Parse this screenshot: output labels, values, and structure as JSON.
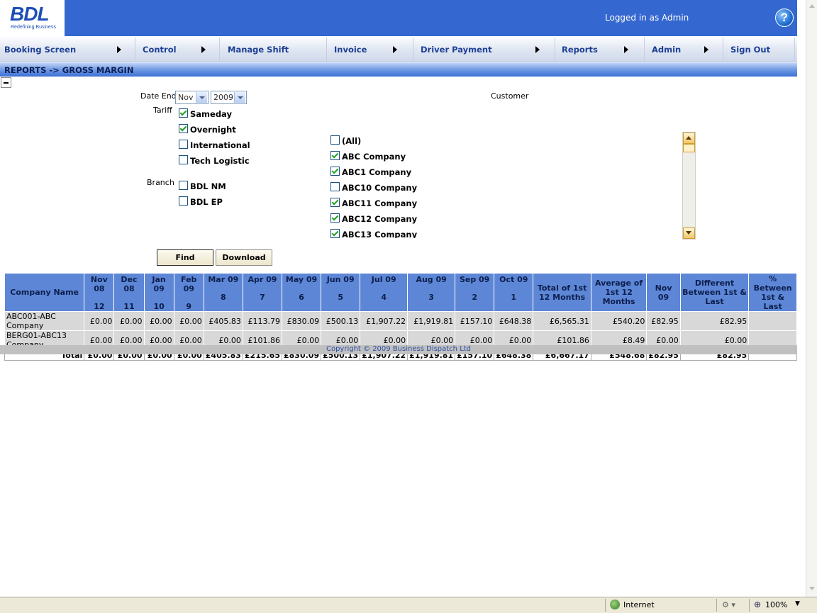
{
  "header": {
    "logo": "BDL",
    "logo_tagline": "Redefining Business",
    "logged_in": "Logged in as Admin",
    "help_icon": "?"
  },
  "menu": [
    {
      "label": "Booking Screen"
    },
    {
      "label": "Control"
    },
    {
      "label": "Manage Shift"
    },
    {
      "label": "Invoice"
    },
    {
      "label": "Driver Payment"
    },
    {
      "label": "Reports"
    },
    {
      "label": "Admin"
    },
    {
      "label": "Sign Out"
    }
  ],
  "title": "REPORTS -> GROSS MARGIN",
  "form": {
    "date_end_label": "Date End",
    "month_value": "Nov",
    "year_value": "2009",
    "tariff_label": "Tariff",
    "tariffs": [
      {
        "label": "Sameday",
        "checked": true
      },
      {
        "label": "Overnight",
        "checked": true
      },
      {
        "label": "International",
        "checked": false
      },
      {
        "label": "Tech Logistic",
        "checked": false
      }
    ],
    "branch_label": "Branch",
    "branches": [
      {
        "label": "BDL NM",
        "checked": false
      },
      {
        "label": "BDL EP",
        "checked": false
      }
    ],
    "customer_label": "Customer",
    "customers": [
      {
        "label": "(All)",
        "checked": false
      },
      {
        "label": "ABC Company",
        "checked": true
      },
      {
        "label": "ABC1 Company",
        "checked": true
      },
      {
        "label": "ABC10 Company",
        "checked": false
      },
      {
        "label": "ABC11 Company",
        "checked": true
      },
      {
        "label": "ABC12 Company",
        "checked": true
      },
      {
        "label": "ABC13 Company",
        "checked": true
      }
    ],
    "find_label": "Find",
    "download_label": "Download"
  },
  "table": {
    "company_header": "Company Name",
    "months": [
      {
        "name": "Nov 08",
        "num": "12"
      },
      {
        "name": "Dec 08",
        "num": "11"
      },
      {
        "name": "Jan 09",
        "num": "10"
      },
      {
        "name": "Feb 09",
        "num": "9"
      },
      {
        "name": "Mar 09",
        "num": "8"
      },
      {
        "name": "Apr 09",
        "num": "7"
      },
      {
        "name": "May 09",
        "num": "6"
      },
      {
        "name": "Jun 09",
        "num": "5"
      },
      {
        "name": "Jul 09",
        "num": "4"
      },
      {
        "name": "Aug 09",
        "num": "3"
      },
      {
        "name": "Sep 09",
        "num": "2"
      },
      {
        "name": "Oct 09",
        "num": "1"
      }
    ],
    "extra_headers": [
      "Total of 1st 12 Months",
      "Average of 1st 12 Months",
      "Nov 09",
      "Different Between 1st & Last",
      "% Between 1st & Last"
    ],
    "rows": [
      {
        "company": "ABC001-ABC Company",
        "values": [
          "£0.00",
          "£0.00",
          "£0.00",
          "£0.00",
          "£405.83",
          "£113.79",
          "£830.09",
          "£500.13",
          "£1,907.22",
          "£1,919.81",
          "£157.10",
          "£648.38",
          "£6,565.31",
          "£540.20",
          "£82.95",
          "£82.95",
          ""
        ]
      },
      {
        "company": "BERG01-ABC13 Company",
        "values": [
          "£0.00",
          "£0.00",
          "£0.00",
          "£0.00",
          "£0.00",
          "£101.86",
          "£0.00",
          "£0.00",
          "£0.00",
          "£0.00",
          "£0.00",
          "£0.00",
          "£101.86",
          "£8.49",
          "£0.00",
          "£0.00",
          ""
        ]
      }
    ],
    "total": {
      "label": "Total",
      "values": [
        "£0.00",
        "£0.00",
        "£0.00",
        "£0.00",
        "£405.83",
        "£215.65",
        "£830.09",
        "£500.13",
        "£1,907.22",
        "£1,919.81",
        "£157.10",
        "£648.38",
        "£6,667.17",
        "£548.68",
        "£82.95",
        "£82.95",
        ""
      ]
    }
  },
  "footer": "Copyright © 2009 Business Dispatch Ltd",
  "statusbar": {
    "zone": "Internet",
    "zoom": "100%"
  }
}
